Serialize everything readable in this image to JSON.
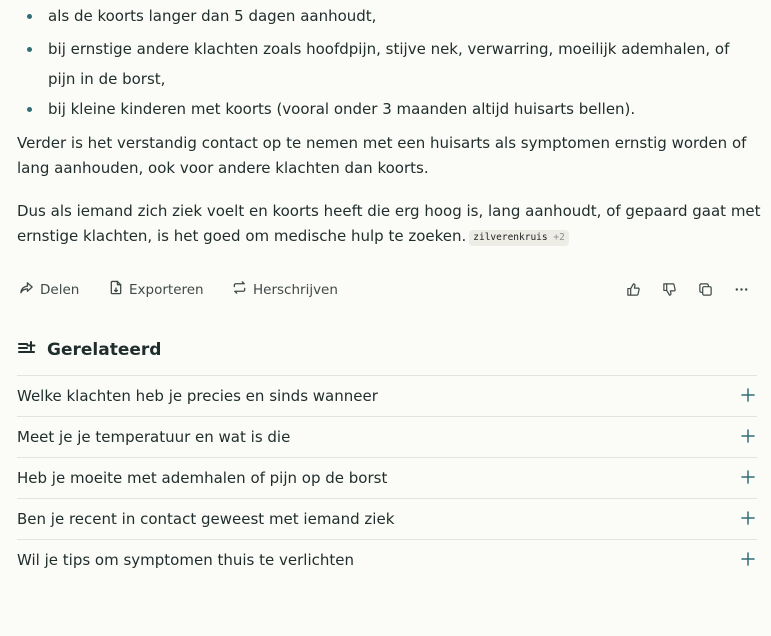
{
  "bullets": [
    "als de koorts langer dan 5 dagen aanhoudt,",
    "bij ernstige andere klachten zoals hoofdpijn, stijve nek, verwarring, moeilijk ademhalen, of pijn in de borst,",
    "bij kleine kinderen met koorts (vooral onder 3 maanden altijd huisarts bellen)."
  ],
  "paragraph1": "Verder is het verstandig contact op te nemen met een huisarts als symptomen ernstig worden of lang aanhouden, ook voor andere klachten dan koorts.",
  "paragraph2": "Dus als iemand zich ziek voelt en koorts heeft die erg hoog is, lang aanhoudt, of gepaard gaat met ernstige klachten, is het goed om medische hulp te zoeken.",
  "citation": {
    "source": "zilverenkruis",
    "count": "+2"
  },
  "actions": {
    "share": "Delen",
    "export": "Exporteren",
    "rewrite": "Herschrijven"
  },
  "related": {
    "title": "Gerelateerd",
    "items": [
      "Welke klachten heb je precies en sinds wanneer",
      "Meet je je temperatuur en wat is die",
      "Heb je moeite met ademhalen of pijn op de borst",
      "Ben je recent in contact geweest met iemand ziek",
      "Wil je tips om symptomen thuis te verlichten"
    ]
  },
  "colors": {
    "background": "#fbfbf7",
    "accent": "#2f6f75",
    "text": "#1f2d2c"
  }
}
